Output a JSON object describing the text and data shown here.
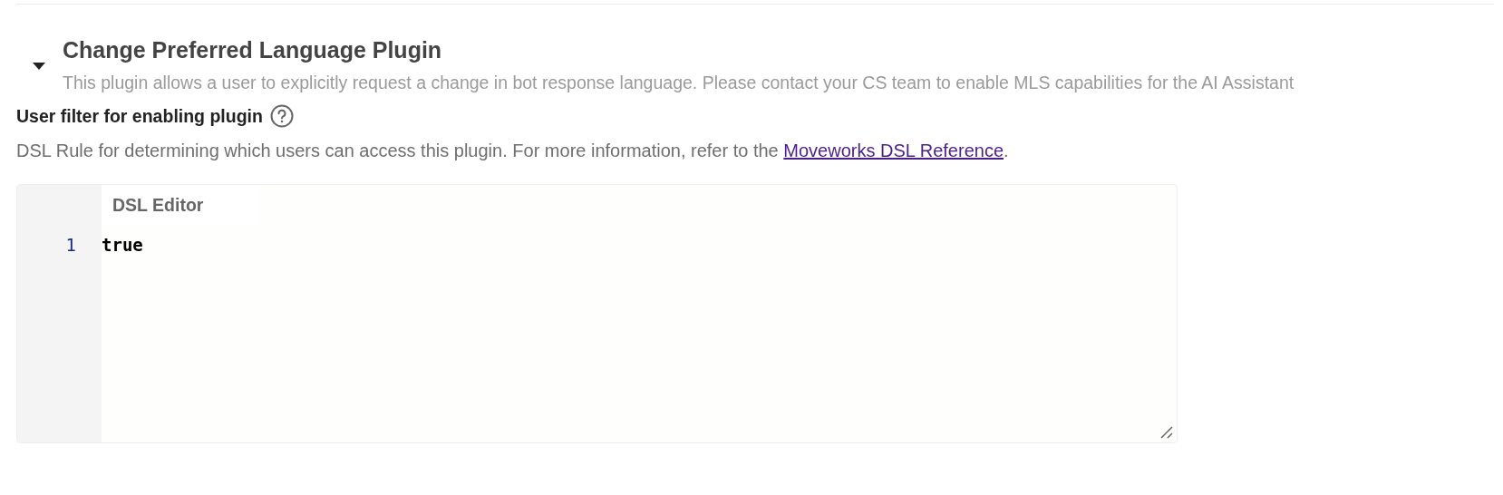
{
  "plugin": {
    "expanded": true,
    "title": "Change Preferred Language Plugin",
    "description": "This plugin allows a user to explicitly request a change in bot response language. Please contact your CS team to enable MLS capabilities for the AI Assistant"
  },
  "user_filter": {
    "label": "User filter for enabling plugin",
    "help_text_before_link": "DSL Rule for determining which users can access this plugin. For more information, refer to the",
    "link": "Moveworks DSL Reference",
    "help_text_after_link": "."
  },
  "editor": {
    "label": "DSL Editor",
    "lines": [
      {
        "number": "1",
        "code": "true"
      }
    ]
  }
}
